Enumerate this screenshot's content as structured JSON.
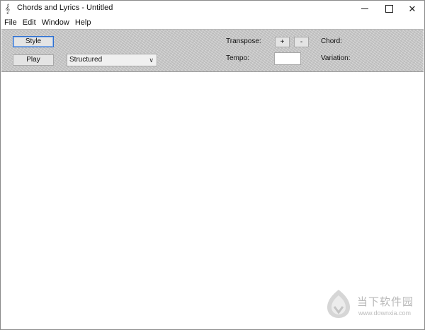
{
  "window": {
    "title": "Chords and Lyrics - Untitled",
    "app_icon": "music-note-icon"
  },
  "menu": {
    "items": [
      {
        "label": "File"
      },
      {
        "label": "Edit"
      },
      {
        "label": "Window"
      },
      {
        "label": "Help"
      }
    ]
  },
  "toolbar": {
    "style_label": "Style",
    "play_label": "Play",
    "arrangement_select": {
      "value": "Structured"
    },
    "transpose_label": "Transpose:",
    "transpose_up_label": "+",
    "transpose_down_label": "-",
    "tempo_label": "Tempo:",
    "tempo_value": "",
    "chord_label": "Chord:",
    "variation_label": "Variation:"
  },
  "watermark": {
    "name_cn": "当下软件园",
    "url": "www.downxia.com"
  }
}
